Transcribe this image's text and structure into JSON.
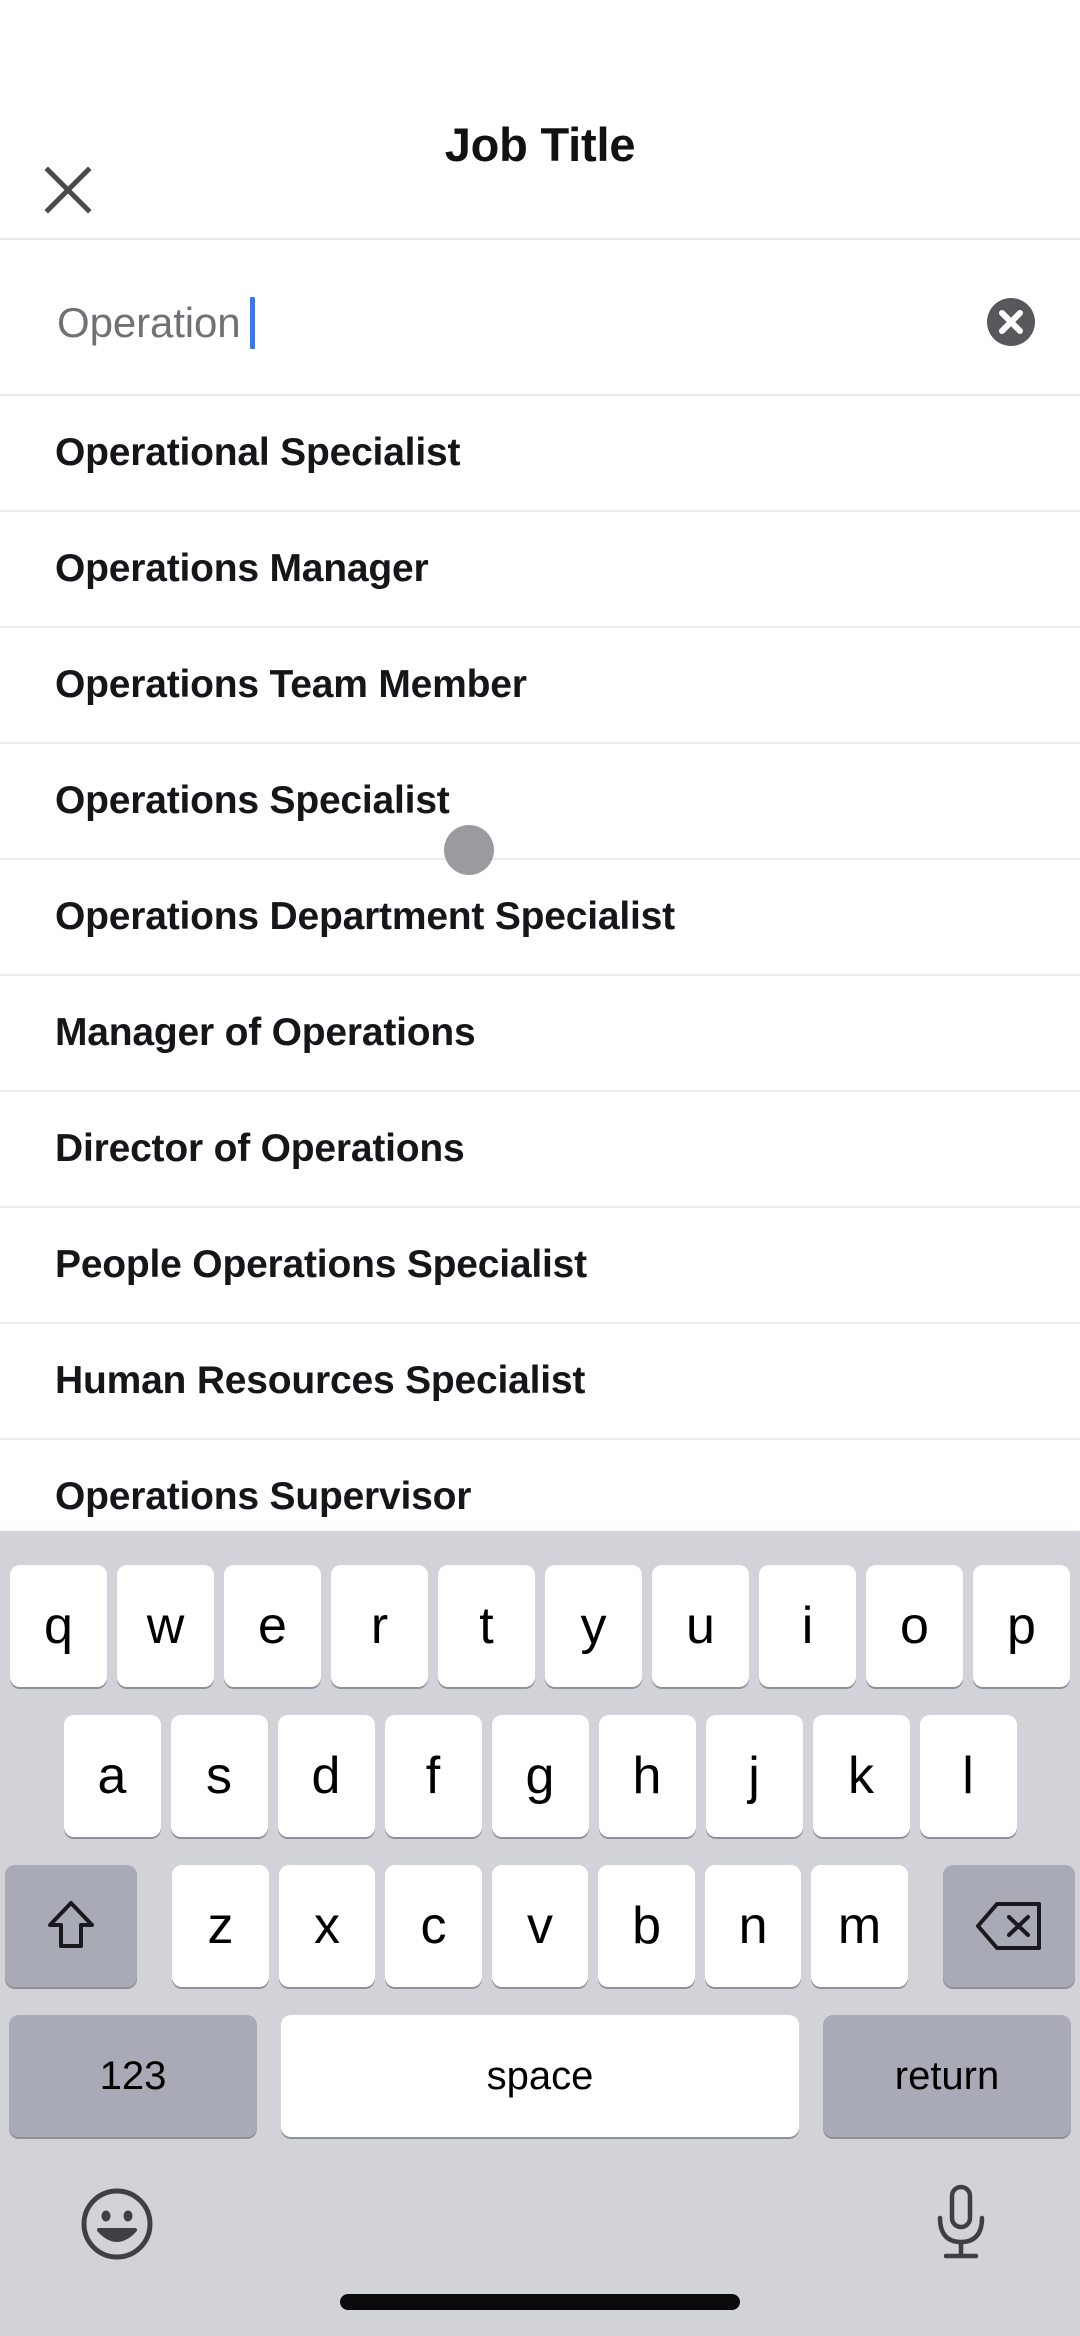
{
  "header": {
    "title": "Job Title",
    "close_icon": "close-x-icon"
  },
  "search": {
    "value": "Operation",
    "clear_icon": "clear-circle-x-icon",
    "caret_color": "#3478f6"
  },
  "results": {
    "items": [
      {
        "label": "Operational Specialist"
      },
      {
        "label": "Operations Manager"
      },
      {
        "label": "Operations Team Member"
      },
      {
        "label": "Operations Specialist"
      },
      {
        "label": "Operations Department Specialist"
      },
      {
        "label": "Manager of Operations"
      },
      {
        "label": "Director of Operations"
      },
      {
        "label": "People Operations Specialist"
      },
      {
        "label": "Human Resources Specialist"
      },
      {
        "label": "Operations Supervisor"
      }
    ]
  },
  "touch_indicator": {
    "name": "touch-point",
    "color": "#9b9b9f"
  },
  "keyboard": {
    "row1": [
      "q",
      "w",
      "e",
      "r",
      "t",
      "y",
      "u",
      "i",
      "o",
      "p"
    ],
    "row2": [
      "a",
      "s",
      "d",
      "f",
      "g",
      "h",
      "j",
      "k",
      "l"
    ],
    "row3": [
      "z",
      "x",
      "c",
      "v",
      "b",
      "n",
      "m"
    ],
    "shift_icon": "shift-arrow-icon",
    "backspace_icon": "backspace-delete-icon",
    "numbers_label": "123",
    "space_label": "space",
    "return_label": "return",
    "emoji_icon": "emoji-smiley-icon",
    "mic_icon": "microphone-icon",
    "background_color": "#d1d3d9",
    "key_color": "#ffffff",
    "modifier_key_color": "#a8abb5"
  }
}
